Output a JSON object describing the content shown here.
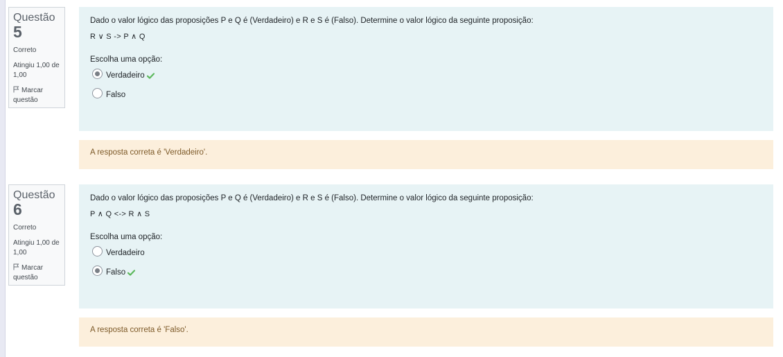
{
  "questions": [
    {
      "label": "Questão",
      "number": "5",
      "state": "Correto",
      "grade": "Atingiu 1,00 de 1,00",
      "flag_label": "Marcar questão",
      "text": "Dado o valor lógico das proposições P e Q é (Verdadeiro) e R e S é (Falso). Determine o valor lógico da seguinte proposição:",
      "proposition": "R ∨ S -> P ∧ Q",
      "prompt": "Escolha uma opção:",
      "options": [
        {
          "label": "Verdadeiro",
          "selected": true,
          "correct": true
        },
        {
          "label": "Falso",
          "selected": false,
          "correct": false
        }
      ],
      "feedback": "A resposta correta é 'Verdadeiro'."
    },
    {
      "label": "Questão",
      "number": "6",
      "state": "Correto",
      "grade": "Atingiu 1,00 de 1,00",
      "flag_label": "Marcar questão",
      "text": "Dado o valor lógico das proposições P e Q é (Verdadeiro) e R e S é (Falso). Determine o valor lógico da seguinte proposição:",
      "proposition": "P ∧ Q <-> R ∧ S",
      "prompt": "Escolha uma opção:",
      "options": [
        {
          "label": "Verdadeiro",
          "selected": false,
          "correct": false
        },
        {
          "label": "Falso",
          "selected": true,
          "correct": true
        }
      ],
      "feedback": "A resposta correta é 'Falso'."
    }
  ],
  "colors": {
    "formulation_bg": "#e7f3f5",
    "feedback_bg": "#fcefdc",
    "feedback_text": "#7d5a29",
    "correct_check": "#5cb85c"
  },
  "icons": {
    "flag": "flag-icon",
    "correct": "check-icon"
  }
}
